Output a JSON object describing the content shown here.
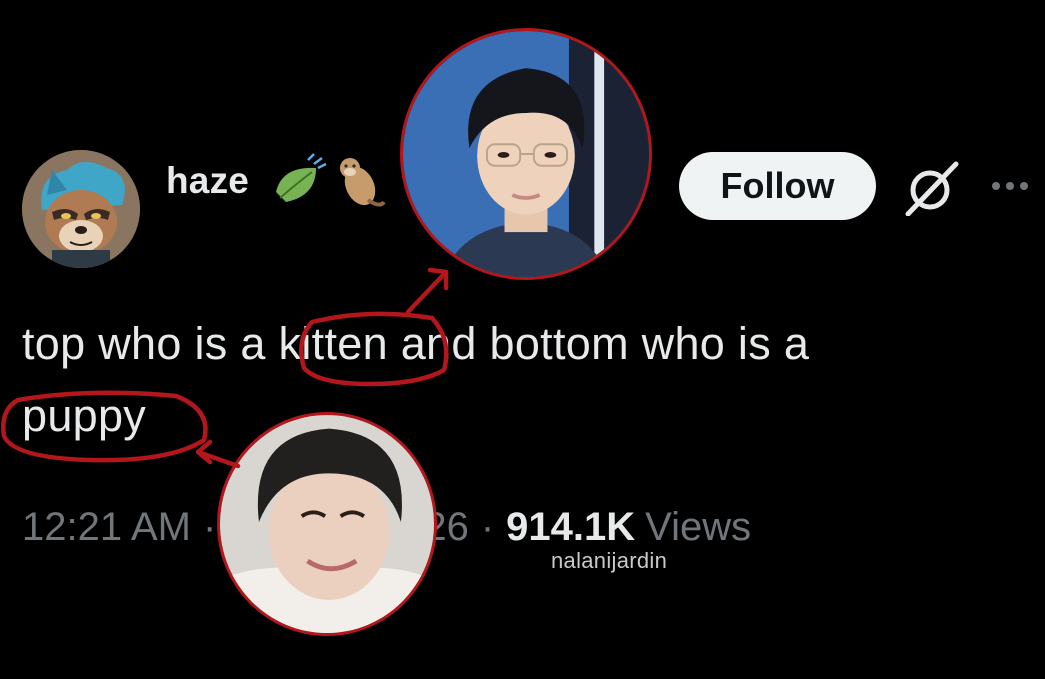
{
  "tweet": {
    "author": {
      "display_name": "haze",
      "avatar_icon": "cartoon-raccoon-avatar",
      "name_emojis": [
        "leaf-fluttering-in-wind",
        "otter"
      ]
    },
    "follow_label": "Follow",
    "grok_icon": "grok-icon",
    "more_icon": "more-options-icon",
    "text_line_1_before": "top who is a ",
    "text_word_kitten": "kitten",
    "text_line_1_after": " and bottom who is a",
    "text_word_puppy": "puppy",
    "time": "12:21 AM",
    "dot": "·",
    "date_tail": "26",
    "views_count": "914.1K",
    "views_label": "Views"
  },
  "overlay": {
    "watermark": "nalanijardin",
    "annotation_color": "#b3161b"
  },
  "colors": {
    "background": "#000000",
    "primary_text": "#e7e9ea",
    "secondary_text": "#71767b",
    "follow_bg": "#eff3f4"
  }
}
